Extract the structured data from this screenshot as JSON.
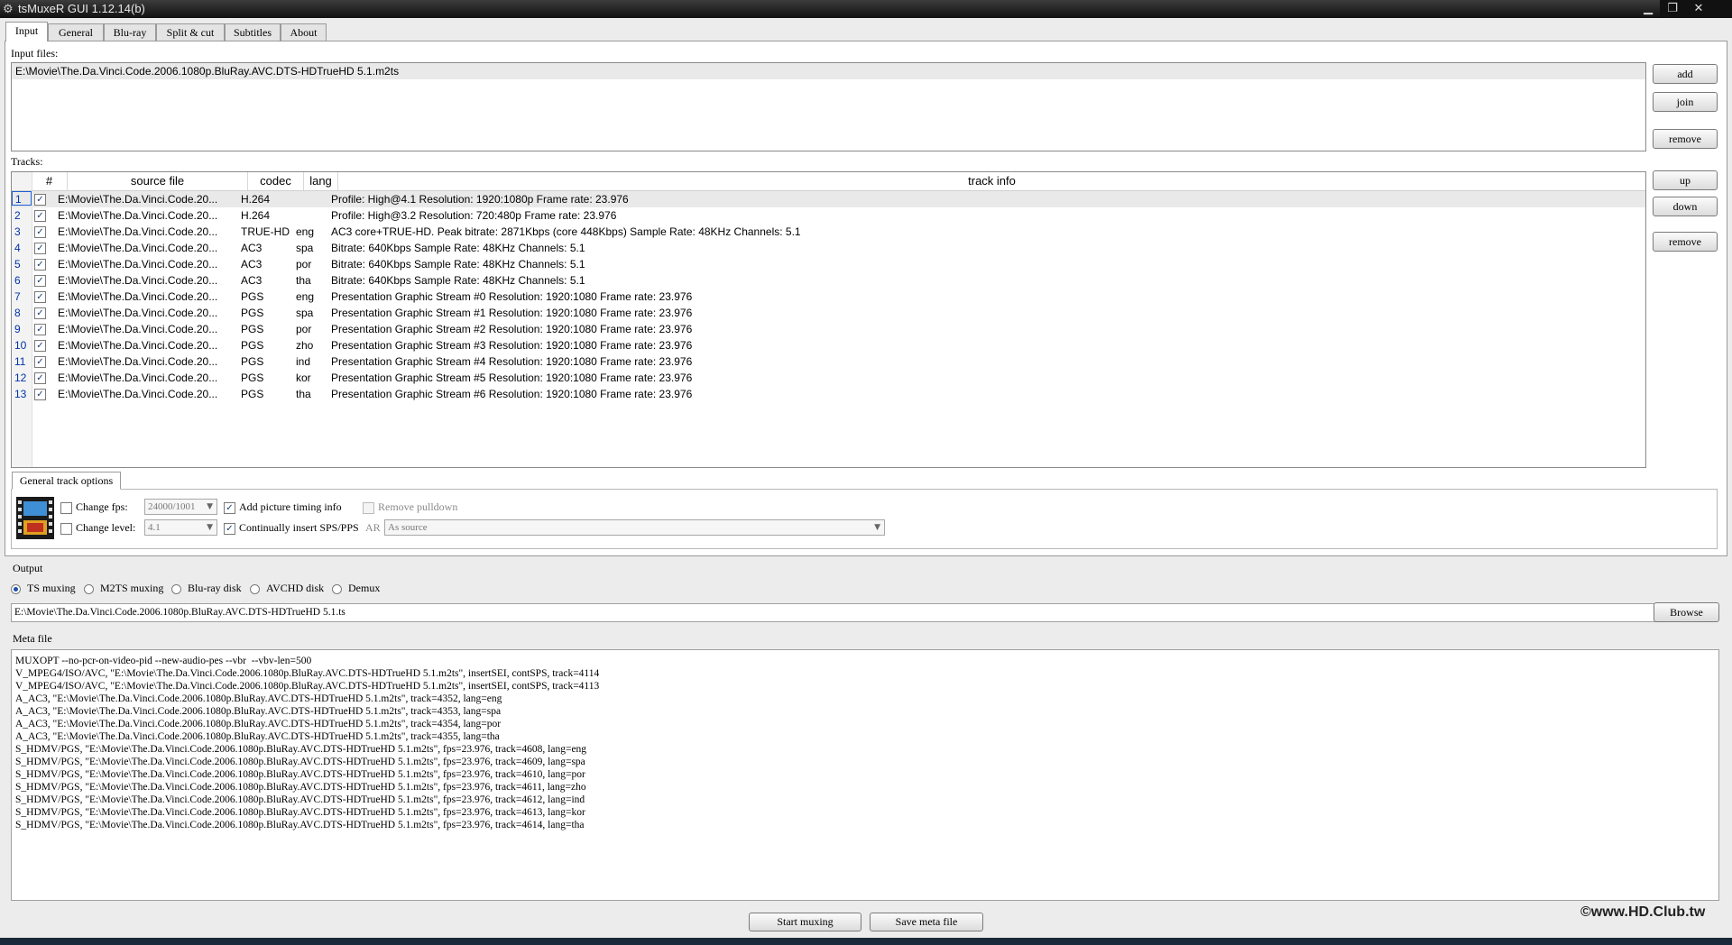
{
  "window": {
    "title": "tsMuxeR GUI 1.12.14(b)",
    "minimize": "▁",
    "restore": "❐",
    "close": "✕"
  },
  "tabs": [
    "Input",
    "General",
    "Blu-ray",
    "Split & cut",
    "Subtitles",
    "About"
  ],
  "input": {
    "input_files_label": "Input files:",
    "files": [
      "E:\\Movie\\The.Da.Vinci.Code.2006.1080p.BluRay.AVC.DTS-HDTrueHD 5.1.m2ts"
    ],
    "add": "add",
    "join": "join",
    "remove": "remove"
  },
  "tracks": {
    "label": "Tracks:",
    "columns": [
      "#",
      "source file",
      "codec",
      "lang",
      "track info"
    ],
    "up": "up",
    "down": "down",
    "remove": "remove",
    "rows": [
      {
        "n": "1",
        "src": "E:\\Movie\\The.Da.Vinci.Code.20...",
        "codec": "H.264",
        "lang": "",
        "info": "Profile: High@4.1  Resolution: 1920:1080p  Frame rate: 23.976"
      },
      {
        "n": "2",
        "src": "E:\\Movie\\The.Da.Vinci.Code.20...",
        "codec": "H.264",
        "lang": "",
        "info": "Profile: High@3.2  Resolution: 720:480p  Frame rate: 23.976"
      },
      {
        "n": "3",
        "src": "E:\\Movie\\The.Da.Vinci.Code.20...",
        "codec": "TRUE-HD",
        "lang": "eng",
        "info": "AC3 core+TRUE-HD. Peak bitrate: 2871Kbps (core 448Kbps) Sample Rate: 48KHz Channels: 5.1"
      },
      {
        "n": "4",
        "src": "E:\\Movie\\The.Da.Vinci.Code.20...",
        "codec": "AC3",
        "lang": "spa",
        "info": "Bitrate: 640Kbps Sample Rate: 48KHz Channels: 5.1"
      },
      {
        "n": "5",
        "src": "E:\\Movie\\The.Da.Vinci.Code.20...",
        "codec": "AC3",
        "lang": "por",
        "info": "Bitrate: 640Kbps Sample Rate: 48KHz Channels: 5.1"
      },
      {
        "n": "6",
        "src": "E:\\Movie\\The.Da.Vinci.Code.20...",
        "codec": "AC3",
        "lang": "tha",
        "info": "Bitrate: 640Kbps Sample Rate: 48KHz Channels: 5.1"
      },
      {
        "n": "7",
        "src": "E:\\Movie\\The.Da.Vinci.Code.20...",
        "codec": "PGS",
        "lang": "eng",
        "info": "Presentation Graphic Stream #0 Resolution: 1920:1080 Frame rate: 23.976"
      },
      {
        "n": "8",
        "src": "E:\\Movie\\The.Da.Vinci.Code.20...",
        "codec": "PGS",
        "lang": "spa",
        "info": "Presentation Graphic Stream #1 Resolution: 1920:1080 Frame rate: 23.976"
      },
      {
        "n": "9",
        "src": "E:\\Movie\\The.Da.Vinci.Code.20...",
        "codec": "PGS",
        "lang": "por",
        "info": "Presentation Graphic Stream #2 Resolution: 1920:1080 Frame rate: 23.976"
      },
      {
        "n": "10",
        "src": "E:\\Movie\\The.Da.Vinci.Code.20...",
        "codec": "PGS",
        "lang": "zho",
        "info": "Presentation Graphic Stream #3 Resolution: 1920:1080 Frame rate: 23.976"
      },
      {
        "n": "11",
        "src": "E:\\Movie\\The.Da.Vinci.Code.20...",
        "codec": "PGS",
        "lang": "ind",
        "info": "Presentation Graphic Stream #4 Resolution: 1920:1080 Frame rate: 23.976"
      },
      {
        "n": "12",
        "src": "E:\\Movie\\The.Da.Vinci.Code.20...",
        "codec": "PGS",
        "lang": "kor",
        "info": "Presentation Graphic Stream #5 Resolution: 1920:1080 Frame rate: 23.976"
      },
      {
        "n": "13",
        "src": "E:\\Movie\\The.Da.Vinci.Code.20...",
        "codec": "PGS",
        "lang": "tha",
        "info": "Presentation Graphic Stream #6 Resolution: 1920:1080 Frame rate: 23.976"
      }
    ]
  },
  "track_options": {
    "tab": "General track options",
    "change_fps": "Change fps:",
    "fps_value": "24000/1001",
    "change_level": "Change level:",
    "level_value": "4.1",
    "add_timing": "Add picture timing info",
    "insert_sps": "Continually insert SPS/PPS",
    "remove_pulldown": "Remove pulldown",
    "ar_label": "AR",
    "ar_value": "As source"
  },
  "output": {
    "label": "Output",
    "modes": [
      "TS muxing",
      "M2TS muxing",
      "Blu-ray disk",
      "AVCHD disk",
      "Demux"
    ],
    "selected_mode": "TS muxing",
    "path": "E:\\Movie\\The.Da.Vinci.Code.2006.1080p.BluRay.AVC.DTS-HDTrueHD 5.1.ts",
    "browse": "Browse"
  },
  "meta": {
    "label": "Meta file",
    "lines": [
      "MUXOPT --no-pcr-on-video-pid --new-audio-pes --vbr  --vbv-len=500",
      "V_MPEG4/ISO/AVC, \"E:\\Movie\\The.Da.Vinci.Code.2006.1080p.BluRay.AVC.DTS-HDTrueHD 5.1.m2ts\", insertSEI, contSPS, track=4114",
      "V_MPEG4/ISO/AVC, \"E:\\Movie\\The.Da.Vinci.Code.2006.1080p.BluRay.AVC.DTS-HDTrueHD 5.1.m2ts\", insertSEI, contSPS, track=4113",
      "A_AC3, \"E:\\Movie\\The.Da.Vinci.Code.2006.1080p.BluRay.AVC.DTS-HDTrueHD 5.1.m2ts\", track=4352, lang=eng",
      "A_AC3, \"E:\\Movie\\The.Da.Vinci.Code.2006.1080p.BluRay.AVC.DTS-HDTrueHD 5.1.m2ts\", track=4353, lang=spa",
      "A_AC3, \"E:\\Movie\\The.Da.Vinci.Code.2006.1080p.BluRay.AVC.DTS-HDTrueHD 5.1.m2ts\", track=4354, lang=por",
      "A_AC3, \"E:\\Movie\\The.Da.Vinci.Code.2006.1080p.BluRay.AVC.DTS-HDTrueHD 5.1.m2ts\", track=4355, lang=tha",
      "S_HDMV/PGS, \"E:\\Movie\\The.Da.Vinci.Code.2006.1080p.BluRay.AVC.DTS-HDTrueHD 5.1.m2ts\", fps=23.976, track=4608, lang=eng",
      "S_HDMV/PGS, \"E:\\Movie\\The.Da.Vinci.Code.2006.1080p.BluRay.AVC.DTS-HDTrueHD 5.1.m2ts\", fps=23.976, track=4609, lang=spa",
      "S_HDMV/PGS, \"E:\\Movie\\The.Da.Vinci.Code.2006.1080p.BluRay.AVC.DTS-HDTrueHD 5.1.m2ts\", fps=23.976, track=4610, lang=por",
      "S_HDMV/PGS, \"E:\\Movie\\The.Da.Vinci.Code.2006.1080p.BluRay.AVC.DTS-HDTrueHD 5.1.m2ts\", fps=23.976, track=4611, lang=zho",
      "S_HDMV/PGS, \"E:\\Movie\\The.Da.Vinci.Code.2006.1080p.BluRay.AVC.DTS-HDTrueHD 5.1.m2ts\", fps=23.976, track=4612, lang=ind",
      "S_HDMV/PGS, \"E:\\Movie\\The.Da.Vinci.Code.2006.1080p.BluRay.AVC.DTS-HDTrueHD 5.1.m2ts\", fps=23.976, track=4613, lang=kor",
      "S_HDMV/PGS, \"E:\\Movie\\The.Da.Vinci.Code.2006.1080p.BluRay.AVC.DTS-HDTrueHD 5.1.m2ts\", fps=23.976, track=4614, lang=tha"
    ]
  },
  "actions": {
    "start": "Start muxing",
    "save_meta": "Save meta file"
  },
  "watermark": "©www.HD.Club.tw",
  "icons": {
    "app": "gear-icon",
    "film": "film-strip-icon",
    "check": "✓"
  }
}
